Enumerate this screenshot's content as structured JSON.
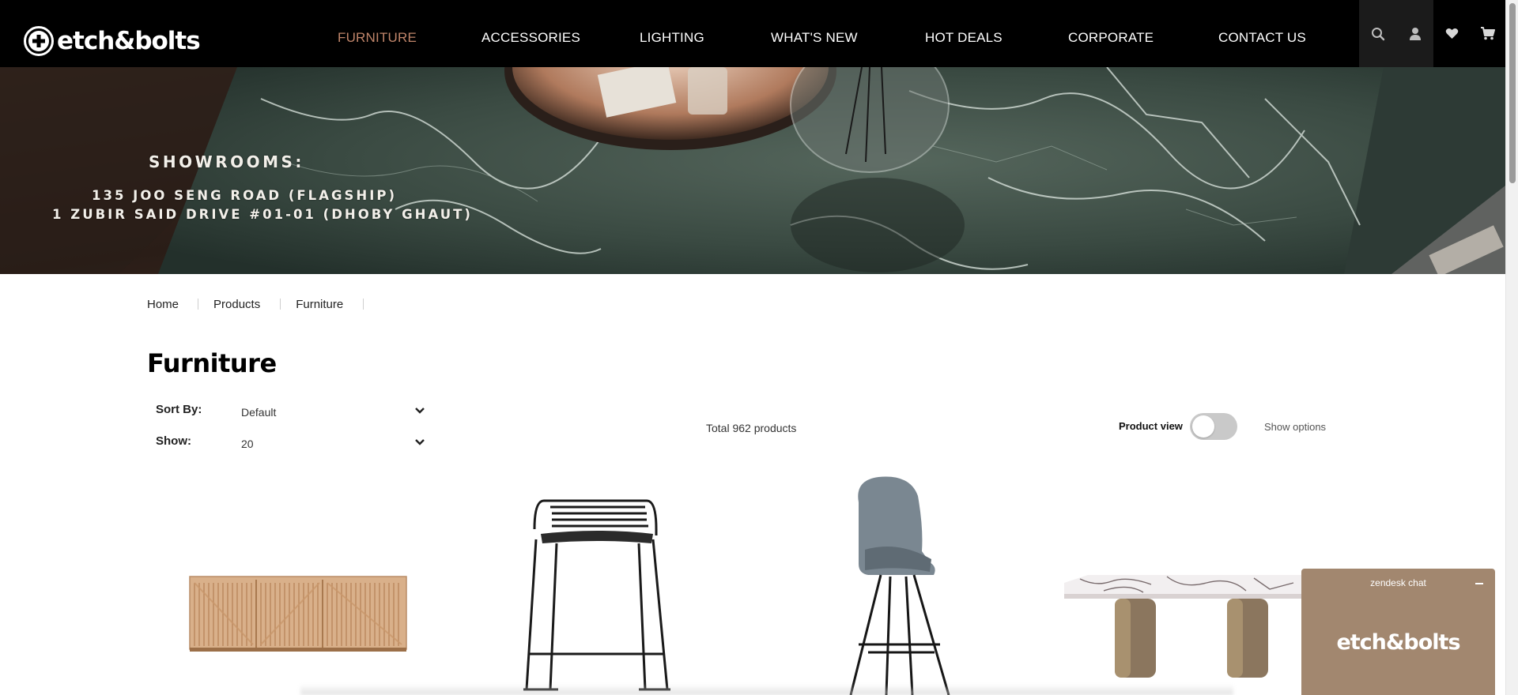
{
  "header": {
    "logo_text": "etch&bolts",
    "nav": [
      {
        "label": "FURNITURE",
        "active": true
      },
      {
        "label": "ACCESSORIES",
        "active": false
      },
      {
        "label": "LIGHTING",
        "active": false
      },
      {
        "label": "WHAT'S NEW",
        "active": false
      },
      {
        "label": "HOT DEALS",
        "active": false
      },
      {
        "label": "CORPORATE",
        "active": false
      },
      {
        "label": "CONTACT US",
        "active": false
      }
    ],
    "icons": [
      "search-icon",
      "account-icon",
      "wishlist-heart-icon",
      "cart-icon"
    ]
  },
  "hero": {
    "title": "SHOWROOMS:",
    "line1": "135 JOO SENG ROAD (FLAGSHIP)",
    "line2": "1 ZUBIR SAID DRIVE #01-01 (DHOBY GHAUT)"
  },
  "breadcrumb": [
    "Home",
    "Products",
    "Furniture"
  ],
  "page_title": "Furniture",
  "toolbar": {
    "sort_label": "Sort By:",
    "sort_value": "Default",
    "show_label": "Show:",
    "show_value": "20",
    "total": "Total 962 products",
    "product_view_label": "Product view",
    "product_view_on": false,
    "show_options": "Show options"
  },
  "products": [
    {
      "image": "wooden-sideboard"
    },
    {
      "image": "wire-bar-stool"
    },
    {
      "image": "grey-bar-chair"
    },
    {
      "image": "marble-dining-table"
    }
  ],
  "chat": {
    "title": "zendesk chat",
    "logo_text": "etch&bolts"
  },
  "colors": {
    "accent": "#c0856a",
    "header_bg": "#000000",
    "chat_bg": "#a2876f"
  }
}
